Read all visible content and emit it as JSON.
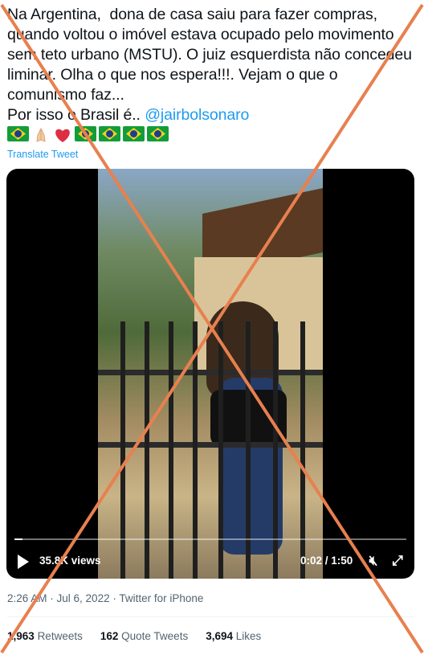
{
  "tweet": {
    "text": "Na Argentina,  dona de casa saiu para fazer compras, quando voltou o imóvel estava ocupado pelo movimento sem teto urbano (MSTU). O juiz esquerdista não concedeu liminar. Olha o que nos espera!!!. Vejam o que o comunismo faz...\nPor isso o Brasil é.. ",
    "mention": "@jairbolsonaro",
    "emojis": [
      "brazil-flag",
      "folded-hands",
      "red-heart",
      "brazil-flag",
      "brazil-flag",
      "brazil-flag",
      "brazil-flag"
    ],
    "translate_label": "Translate Tweet"
  },
  "video": {
    "views": "35.8K views",
    "time": "0:02 / 1:50",
    "progress": 0.02
  },
  "meta": {
    "time": "2:26 AM",
    "sep1": " · ",
    "date": "Jul 6, 2022",
    "sep2": " · ",
    "source": "Twitter for iPhone"
  },
  "stats": {
    "retweets_count": "1,963",
    "retweets_label": "Retweets",
    "quotes_count": "162",
    "quotes_label": "Quote Tweets",
    "likes_count": "3,694",
    "likes_label": "Likes"
  },
  "colors": {
    "accent": "#1d9bf0",
    "overlay_cross": "#e8804f"
  }
}
